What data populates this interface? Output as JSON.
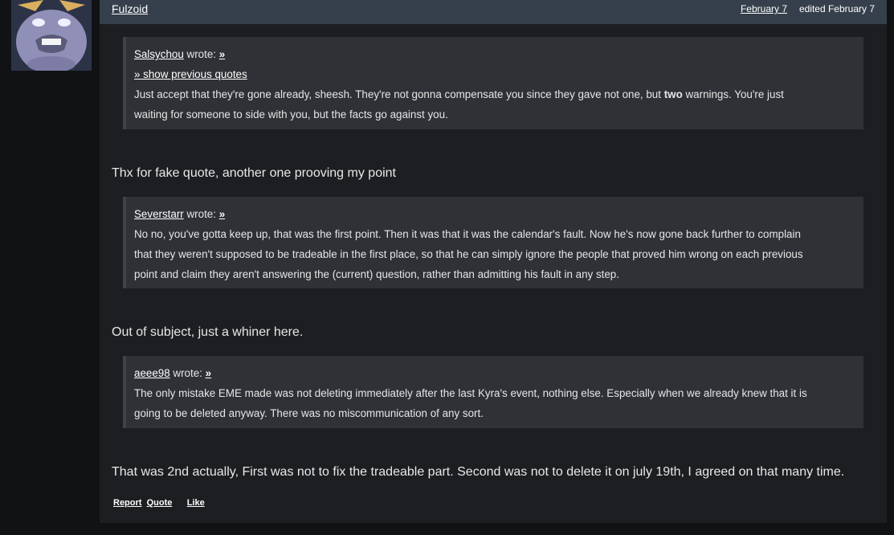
{
  "post": {
    "author": "Fulzoid",
    "date": "February 7",
    "edited": "edited February 7"
  },
  "quotes": [
    {
      "user": "Salsychou",
      "wrote": "wrote:",
      "arrow": "»",
      "show_previous": "» show previous quotes",
      "text_before": "Just accept that they're gone already, sheesh. They're not gonna compensate you since they gave not one, but ",
      "text_bold": "two",
      "text_after": " warnings. You're just",
      "line2": "waiting for someone to side with you, but the facts go against you."
    },
    {
      "user": "Severstarr",
      "wrote": "wrote:",
      "arrow": "»",
      "line1": "No no, you've gotta keep up, that was the first point. Then it was that it was the calendar's fault. Now he's now gone back further to complain",
      "line2": "that they weren't supposed to be tradeable in the first place, so that he can simply ignore the people that proved him wrong on each previous",
      "line3": "point and claim they aren't answering the (current) question, rather than admitting his fault in any step."
    },
    {
      "user": "aeee98",
      "wrote": "wrote:",
      "arrow": "»",
      "line1": "The only mistake EME made was not deleting immediately after the last Kyra's event, nothing else. Especially when we already knew that it is",
      "line2": "going to be deleted anyway. There was no miscommunication of any sort."
    }
  ],
  "replies": [
    "Thx for fake quote, another one prooving my point",
    "Out of subject, just a whiner here.",
    "That was 2nd actually, First was not to fix the tradeable part. Second was not to delete it on july 19th, I agreed on that many time."
  ],
  "actions": {
    "report": "Report",
    "quote": "Quote",
    "like": "Like"
  },
  "colors": {
    "page_bg": "#111214",
    "post_bg": "#1c1e22",
    "header_bg": "#36404c",
    "quote_bg": "#2f3136"
  }
}
